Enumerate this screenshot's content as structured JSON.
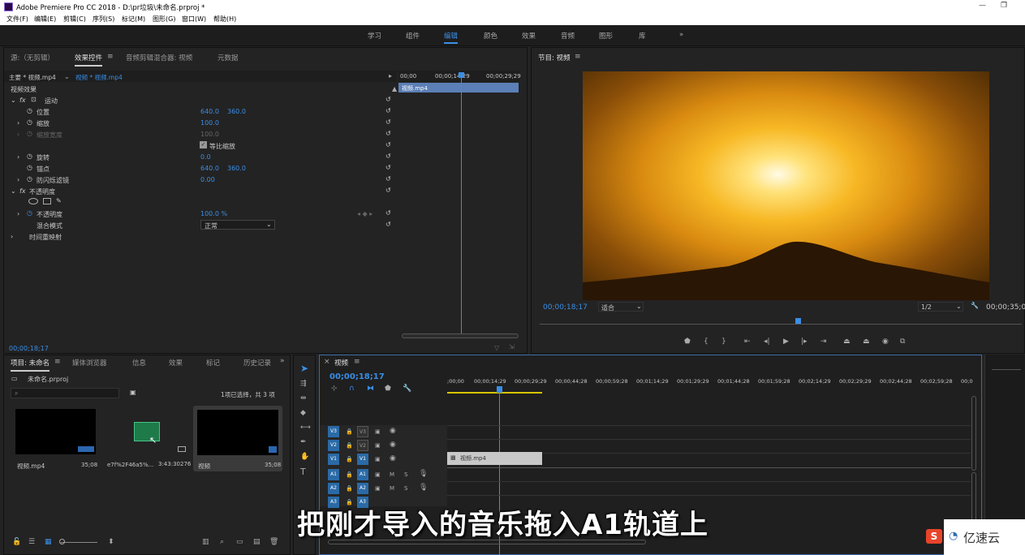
{
  "app": {
    "title": "Adobe Premiere Pro CC 2018 - D:\\pr垃圾\\未命名.prproj *"
  },
  "menu": [
    "文件(F)",
    "编辑(E)",
    "剪辑(C)",
    "序列(S)",
    "标记(M)",
    "图形(G)",
    "窗口(W)",
    "帮助(H)"
  ],
  "workspaces": [
    "学习",
    "组件",
    "编辑",
    "颜色",
    "效果",
    "音频",
    "图形",
    "库"
  ],
  "source_panel": {
    "tabs": [
      "源:（无剪辑）",
      "效果控件",
      "音频剪辑混合器: 视频",
      "元数据"
    ],
    "master_label": "主要 * 视频.mp4",
    "clip_label": "视频 * 视频.mp4",
    "timecodes": [
      "00;00",
      "00;00;14;29",
      "00;00;29;29"
    ],
    "clip_name": "视频.mp4",
    "section_video": "视频效果",
    "motion": "运动",
    "props": [
      {
        "name": "位置",
        "v1": "640.0",
        "v2": "360.0"
      },
      {
        "name": "缩放",
        "v1": "100.0",
        "v2": ""
      },
      {
        "name": "缩放宽度",
        "v1": "100.0",
        "v2": ""
      },
      {
        "name": "等比缩放",
        "v1": "",
        "v2": ""
      },
      {
        "name": "旋转",
        "v1": "0.0",
        "v2": ""
      },
      {
        "name": "锚点",
        "v1": "640.0",
        "v2": "360.0"
      },
      {
        "name": "防闪烁滤镜",
        "v1": "0.00",
        "v2": ""
      }
    ],
    "opacity_section": "不透明度",
    "opacity_label": "不透明度",
    "opacity_value": "100.0 %",
    "blend_label": "混合模式",
    "blend_value": "正常",
    "time_remap": "时间重映射",
    "current_time": "00;00;18;17"
  },
  "program": {
    "title": "节目: 视频",
    "timecode": "00;00;18;17",
    "fit": "适合",
    "quality": "1/2",
    "duration": "00;00;35;08"
  },
  "project": {
    "tabs": [
      "项目: 未命名",
      "媒体浏览器",
      "信息",
      "效果",
      "标记",
      "历史记录"
    ],
    "file": "未命名.prproj",
    "selection": "1项已选择，共 3 项",
    "items": [
      {
        "name": "视频.mp4",
        "duration": "35;08"
      },
      {
        "name": "e7f%2F46a5%...",
        "duration": "3:43:30276"
      },
      {
        "name": "视频",
        "duration": "35;08"
      }
    ]
  },
  "timeline": {
    "tab": "视频",
    "timecode": "00;00;18;17",
    "ruler": [
      ";00;00",
      "00;00;14;29",
      "00;00;29;29",
      "00;00;44;28",
      "00;00;59;28",
      "00;01;14;29",
      "00;01;29;29",
      "00;01;44;28",
      "00;01;59;28",
      "00;02;14;29",
      "00;02;29;29",
      "00;02;44;28",
      "00;02;59;28",
      "00;0"
    ],
    "video_tracks": [
      "V3",
      "V2",
      "V1"
    ],
    "audio_tracks": [
      "A1",
      "A2",
      "A3"
    ],
    "clip": "视频.mp4"
  },
  "subtitle": "把刚才导入的音乐拖入A1轨道上",
  "watermark": {
    "badge": "S",
    "text": "亿速云"
  },
  "colors": {
    "accent": "#3a8ee6",
    "timeline_bg": "#1f1f1f",
    "clip": "#c8c8c8"
  }
}
